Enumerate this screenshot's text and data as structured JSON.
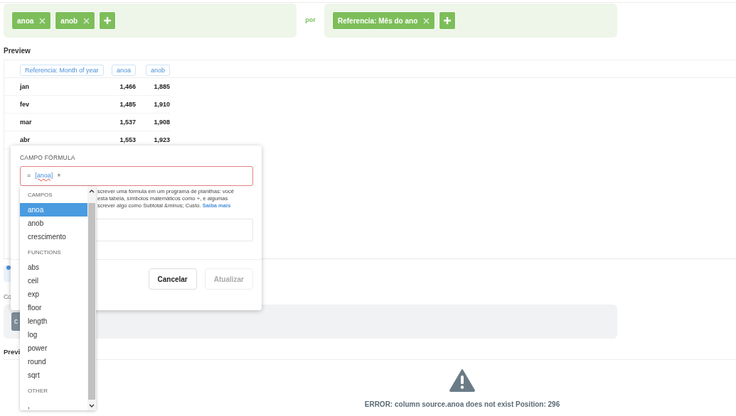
{
  "filters": {
    "left_chips": [
      {
        "label": "anoa"
      },
      {
        "label": "anob"
      }
    ],
    "connector": "por",
    "right_chips": [
      {
        "label": "Referencia: Mês do ano"
      }
    ]
  },
  "preview_title": "Preview",
  "table": {
    "columns": [
      "Referencia: Month of year",
      "anoa",
      "anob"
    ],
    "rows": [
      [
        "jan",
        "1,466",
        "1,885"
      ],
      [
        "fev",
        "1,485",
        "1,910"
      ],
      [
        "mar",
        "1,537",
        "1,908"
      ],
      [
        "abr",
        "1,553",
        "1,923"
      ]
    ]
  },
  "section_label": "Co",
  "section_button": "c",
  "preview2_title": "Previ",
  "error": "ERROR: column source.anoa does not exist Position: 296",
  "formula_dialog": {
    "label": "CAMPO FÓRMULA",
    "formula": {
      "prefix": "=",
      "field": "[anoa]",
      "operator": "+",
      "invalid": true
    },
    "help_lines": [
      "screver uma fórmula em um programa de planilhas: você",
      "esta tabela, símbolos matemáticos como +, e algumas",
      "screver algo como Subtotal &minus; Custo."
    ],
    "help_link": "Saiba mais",
    "buttons": [
      {
        "label": "Cancelar",
        "disabled": false
      },
      {
        "label": "Atualizar",
        "disabled": true
      }
    ]
  },
  "autocomplete": {
    "groups": [
      {
        "title": "CAMPOS",
        "items": [
          {
            "label": "anoa",
            "selected": true
          },
          {
            "label": "anob",
            "selected": false
          },
          {
            "label": "crescimento",
            "selected": false
          }
        ]
      },
      {
        "title": "FUNCTIONS",
        "items": [
          {
            "label": "abs",
            "selected": false
          },
          {
            "label": "ceil",
            "selected": false
          },
          {
            "label": "exp",
            "selected": false
          },
          {
            "label": "floor",
            "selected": false
          },
          {
            "label": "length",
            "selected": false
          },
          {
            "label": "log",
            "selected": false
          },
          {
            "label": "power",
            "selected": false
          },
          {
            "label": "round",
            "selected": false
          },
          {
            "label": "sqrt",
            "selected": false
          }
        ]
      },
      {
        "title": "OTHER",
        "items": [
          {
            "label": ",",
            "selected": false
          }
        ]
      }
    ]
  }
}
